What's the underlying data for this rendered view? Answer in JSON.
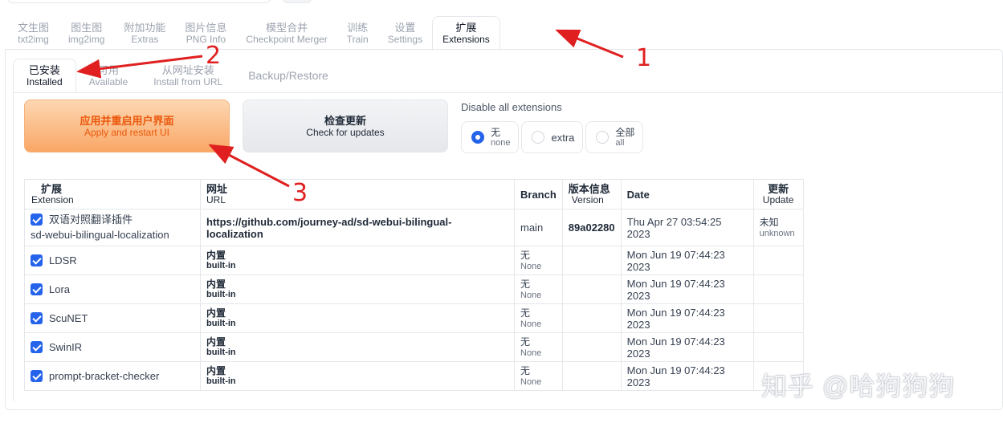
{
  "main_tabs": [
    {
      "cn": "文生图",
      "en": "txt2img"
    },
    {
      "cn": "图生图",
      "en": "img2img"
    },
    {
      "cn": "附加功能",
      "en": "Extras"
    },
    {
      "cn": "图片信息",
      "en": "PNG Info"
    },
    {
      "cn": "模型合并",
      "en": "Checkpoint Merger"
    },
    {
      "cn": "训练",
      "en": "Train"
    },
    {
      "cn": "设置",
      "en": "Settings"
    },
    {
      "cn": "扩展",
      "en": "Extensions"
    }
  ],
  "sub_tabs": [
    {
      "cn": "已安装",
      "en": "Installed"
    },
    {
      "cn": "可用",
      "en": "Available"
    },
    {
      "cn": "从网址安装",
      "en": "Install from URL"
    },
    {
      "label": "Backup/Restore"
    }
  ],
  "buttons": {
    "apply": {
      "cn": "应用并重启用户界面",
      "en": "Apply and restart UI"
    },
    "check": {
      "cn": "检查更新",
      "en": "Check for updates"
    }
  },
  "disable": {
    "label": "Disable all extensions",
    "options": [
      {
        "cn": "无",
        "en": "none",
        "selected": true
      },
      {
        "label": "extra",
        "selected": false
      },
      {
        "cn": "全部",
        "en": "all",
        "selected": false
      }
    ]
  },
  "table": {
    "headers": [
      {
        "cn": "扩展",
        "en": "Extension"
      },
      {
        "cn": "网址",
        "en": "URL"
      },
      {
        "label": "Branch"
      },
      {
        "cn": "版本信息",
        "en": "Version"
      },
      {
        "label": "Date"
      },
      {
        "cn": "更新",
        "en": "Update"
      }
    ],
    "rows": [
      {
        "name_cn": "双语对照翻译插件",
        "name": "sd-webui-bilingual-localization",
        "url": "https://github.com/journey-ad/sd-webui-bilingual-localization",
        "branch": "main",
        "version": "89a02280",
        "date": "Thu Apr 27 03:54:25 2023",
        "update_cn": "未知",
        "update_en": "unknown"
      },
      {
        "name": "LDSR",
        "url_cn": "内置",
        "url_en": "built-in",
        "branch_cn": "无",
        "branch_en": "None",
        "date": "Mon Jun 19 07:44:23 2023"
      },
      {
        "name": "Lora",
        "url_cn": "内置",
        "url_en": "built-in",
        "branch_cn": "无",
        "branch_en": "None",
        "date": "Mon Jun 19 07:44:23 2023"
      },
      {
        "name": "ScuNET",
        "url_cn": "内置",
        "url_en": "built-in",
        "branch_cn": "无",
        "branch_en": "None",
        "date": "Mon Jun 19 07:44:23 2023"
      },
      {
        "name": "SwinIR",
        "url_cn": "内置",
        "url_en": "built-in",
        "branch_cn": "无",
        "branch_en": "None",
        "date": "Mon Jun 19 07:44:23 2023"
      },
      {
        "name": "prompt-bracket-checker",
        "url_cn": "内置",
        "url_en": "built-in",
        "branch_cn": "无",
        "branch_en": "None",
        "date": "Mon Jun 19 07:44:23 2023"
      }
    ]
  },
  "annotations": [
    "1",
    "2",
    "3"
  ],
  "watermark": "知乎 @哈狗狗狗",
  "colors": {
    "accent": "#2563eb",
    "apply_text": "#ea580c",
    "annotation": "#e02020"
  }
}
